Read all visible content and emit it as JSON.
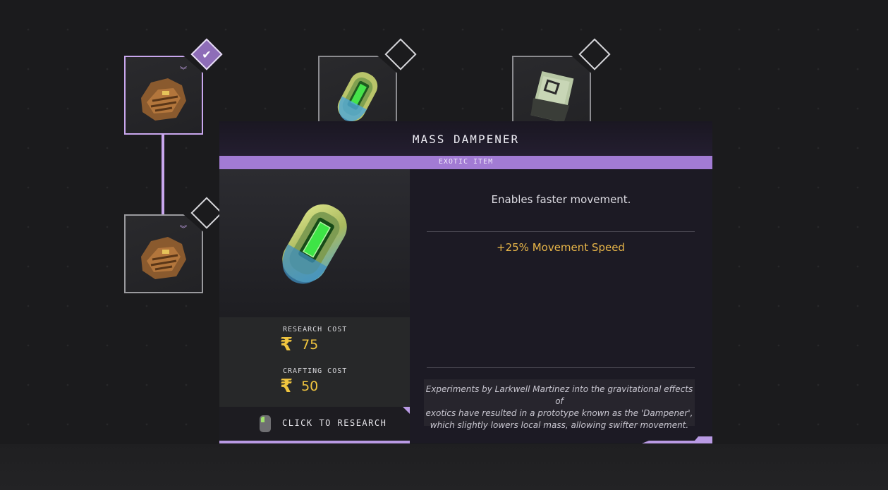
{
  "tree": {
    "nodes": [
      {
        "id": "node-1",
        "state": "researched",
        "art": "gloves",
        "rank_icon": "chevron-double-icon"
      },
      {
        "id": "node-2",
        "state": "locked",
        "art": "mass-dampener"
      },
      {
        "id": "node-3",
        "state": "locked",
        "art": "pack"
      },
      {
        "id": "node-4",
        "state": "available",
        "art": "gloves",
        "rank_icon": "chevron-triple-icon"
      }
    ],
    "check_glyph": "✔"
  },
  "panel": {
    "title": "MASS DAMPENER",
    "rarity": "EXOTIC ITEM",
    "rarity_color": "#a27bd4",
    "description": "Enables faster movement.",
    "stats": [
      "+25% Movement Speed"
    ],
    "stat_color": "#e7b548",
    "research_cost_label": "RESEARCH COST",
    "research_cost": "75",
    "crafting_cost_label": "CRAFTING COST",
    "crafting_cost": "50",
    "currency_glyph": "₹",
    "research_button": "CLICK TO RESEARCH",
    "lore_lines": [
      "Experiments by Larkwell Martinez into the gravitational effects of",
      "exotics have resulted in a prototype known as the 'Dampener',",
      "which slightly lowers local mass, allowing swifter movement."
    ]
  }
}
